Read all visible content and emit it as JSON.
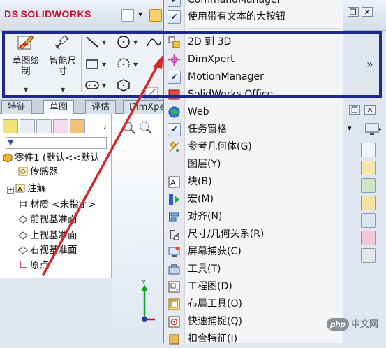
{
  "app": {
    "logo_prefix": "DS",
    "logo_text": "SOLIDWORKS"
  },
  "command_manager": {
    "sketch_label": "草图绘\n制",
    "smart_dim_label": "智能尺\n寸"
  },
  "tabs": [
    "特征",
    "草图",
    "评估",
    "DimXpert"
  ],
  "active_tab": 1,
  "feature_tree": {
    "filter_icon": "funnel-icon",
    "items": [
      {
        "label": "零件1 (默认<<默认",
        "icon": "part-icon",
        "indent": 0
      },
      {
        "label": "传感器",
        "icon": "sensor-icon",
        "indent": 1
      },
      {
        "label": "注解",
        "icon": "annotation-icon",
        "indent": 1,
        "expandable": true
      },
      {
        "label": "材质 <未指定>",
        "icon": "material-icon",
        "indent": 1
      },
      {
        "label": "前视基准面",
        "icon": "plane-icon",
        "indent": 1
      },
      {
        "label": "上视基准面",
        "icon": "plane-icon",
        "indent": 1
      },
      {
        "label": "右视基准面",
        "icon": "plane-icon",
        "indent": 1
      },
      {
        "label": "原点",
        "icon": "origin-icon",
        "indent": 1
      }
    ]
  },
  "axis": {
    "y_label": "Y"
  },
  "context_menu": {
    "items": [
      {
        "label": "CommandManager",
        "checked": true,
        "icon": "check-icon"
      },
      {
        "label": "使用带有文本的大按钮",
        "checked": true,
        "icon": "check-icon"
      },
      {
        "separator": true
      },
      {
        "label": "2D 到 3D",
        "icon": "2d-to-3d-icon"
      },
      {
        "label": "DimXpert",
        "icon": "dimxpert-icon"
      },
      {
        "label": "MotionManager",
        "checked": true,
        "icon": "check-icon"
      },
      {
        "label": "SolidWorks Office",
        "icon": "solidworks-office-icon"
      },
      {
        "separator": true
      },
      {
        "label": "Web",
        "icon": "globe-icon"
      },
      {
        "label": "任务窗格",
        "checked": true,
        "icon": "check-icon"
      },
      {
        "label": "参考几何体(G)",
        "icon": "reference-geometry-icon"
      },
      {
        "label": "图层(Y)",
        "icon": "layer-icon"
      },
      {
        "label": "块(B)",
        "icon": "block-icon"
      },
      {
        "label": "宏(M)",
        "icon": "macro-icon"
      },
      {
        "label": "对齐(N)",
        "icon": "align-icon"
      },
      {
        "label": "尺寸/几何关系(R)",
        "icon": "dimension-relation-icon"
      },
      {
        "label": "屏幕捕获(C)",
        "icon": "screen-capture-icon"
      },
      {
        "label": "工具(T)",
        "icon": "tools-icon"
      },
      {
        "label": "工程图(D)",
        "icon": "drawing-icon"
      },
      {
        "label": "布局工具(O)",
        "icon": "layout-tools-icon"
      },
      {
        "label": "快速捕捉(Q)",
        "icon": "quick-snap-icon"
      },
      {
        "label": "扣合特征(I)",
        "icon": "fastening-feature-icon"
      }
    ]
  },
  "watermark": {
    "badge": "php",
    "text": "中文网"
  },
  "colors": {
    "highlight": "#1c2a8f",
    "arrow": "#d3272b",
    "brand": "#c8102e"
  }
}
